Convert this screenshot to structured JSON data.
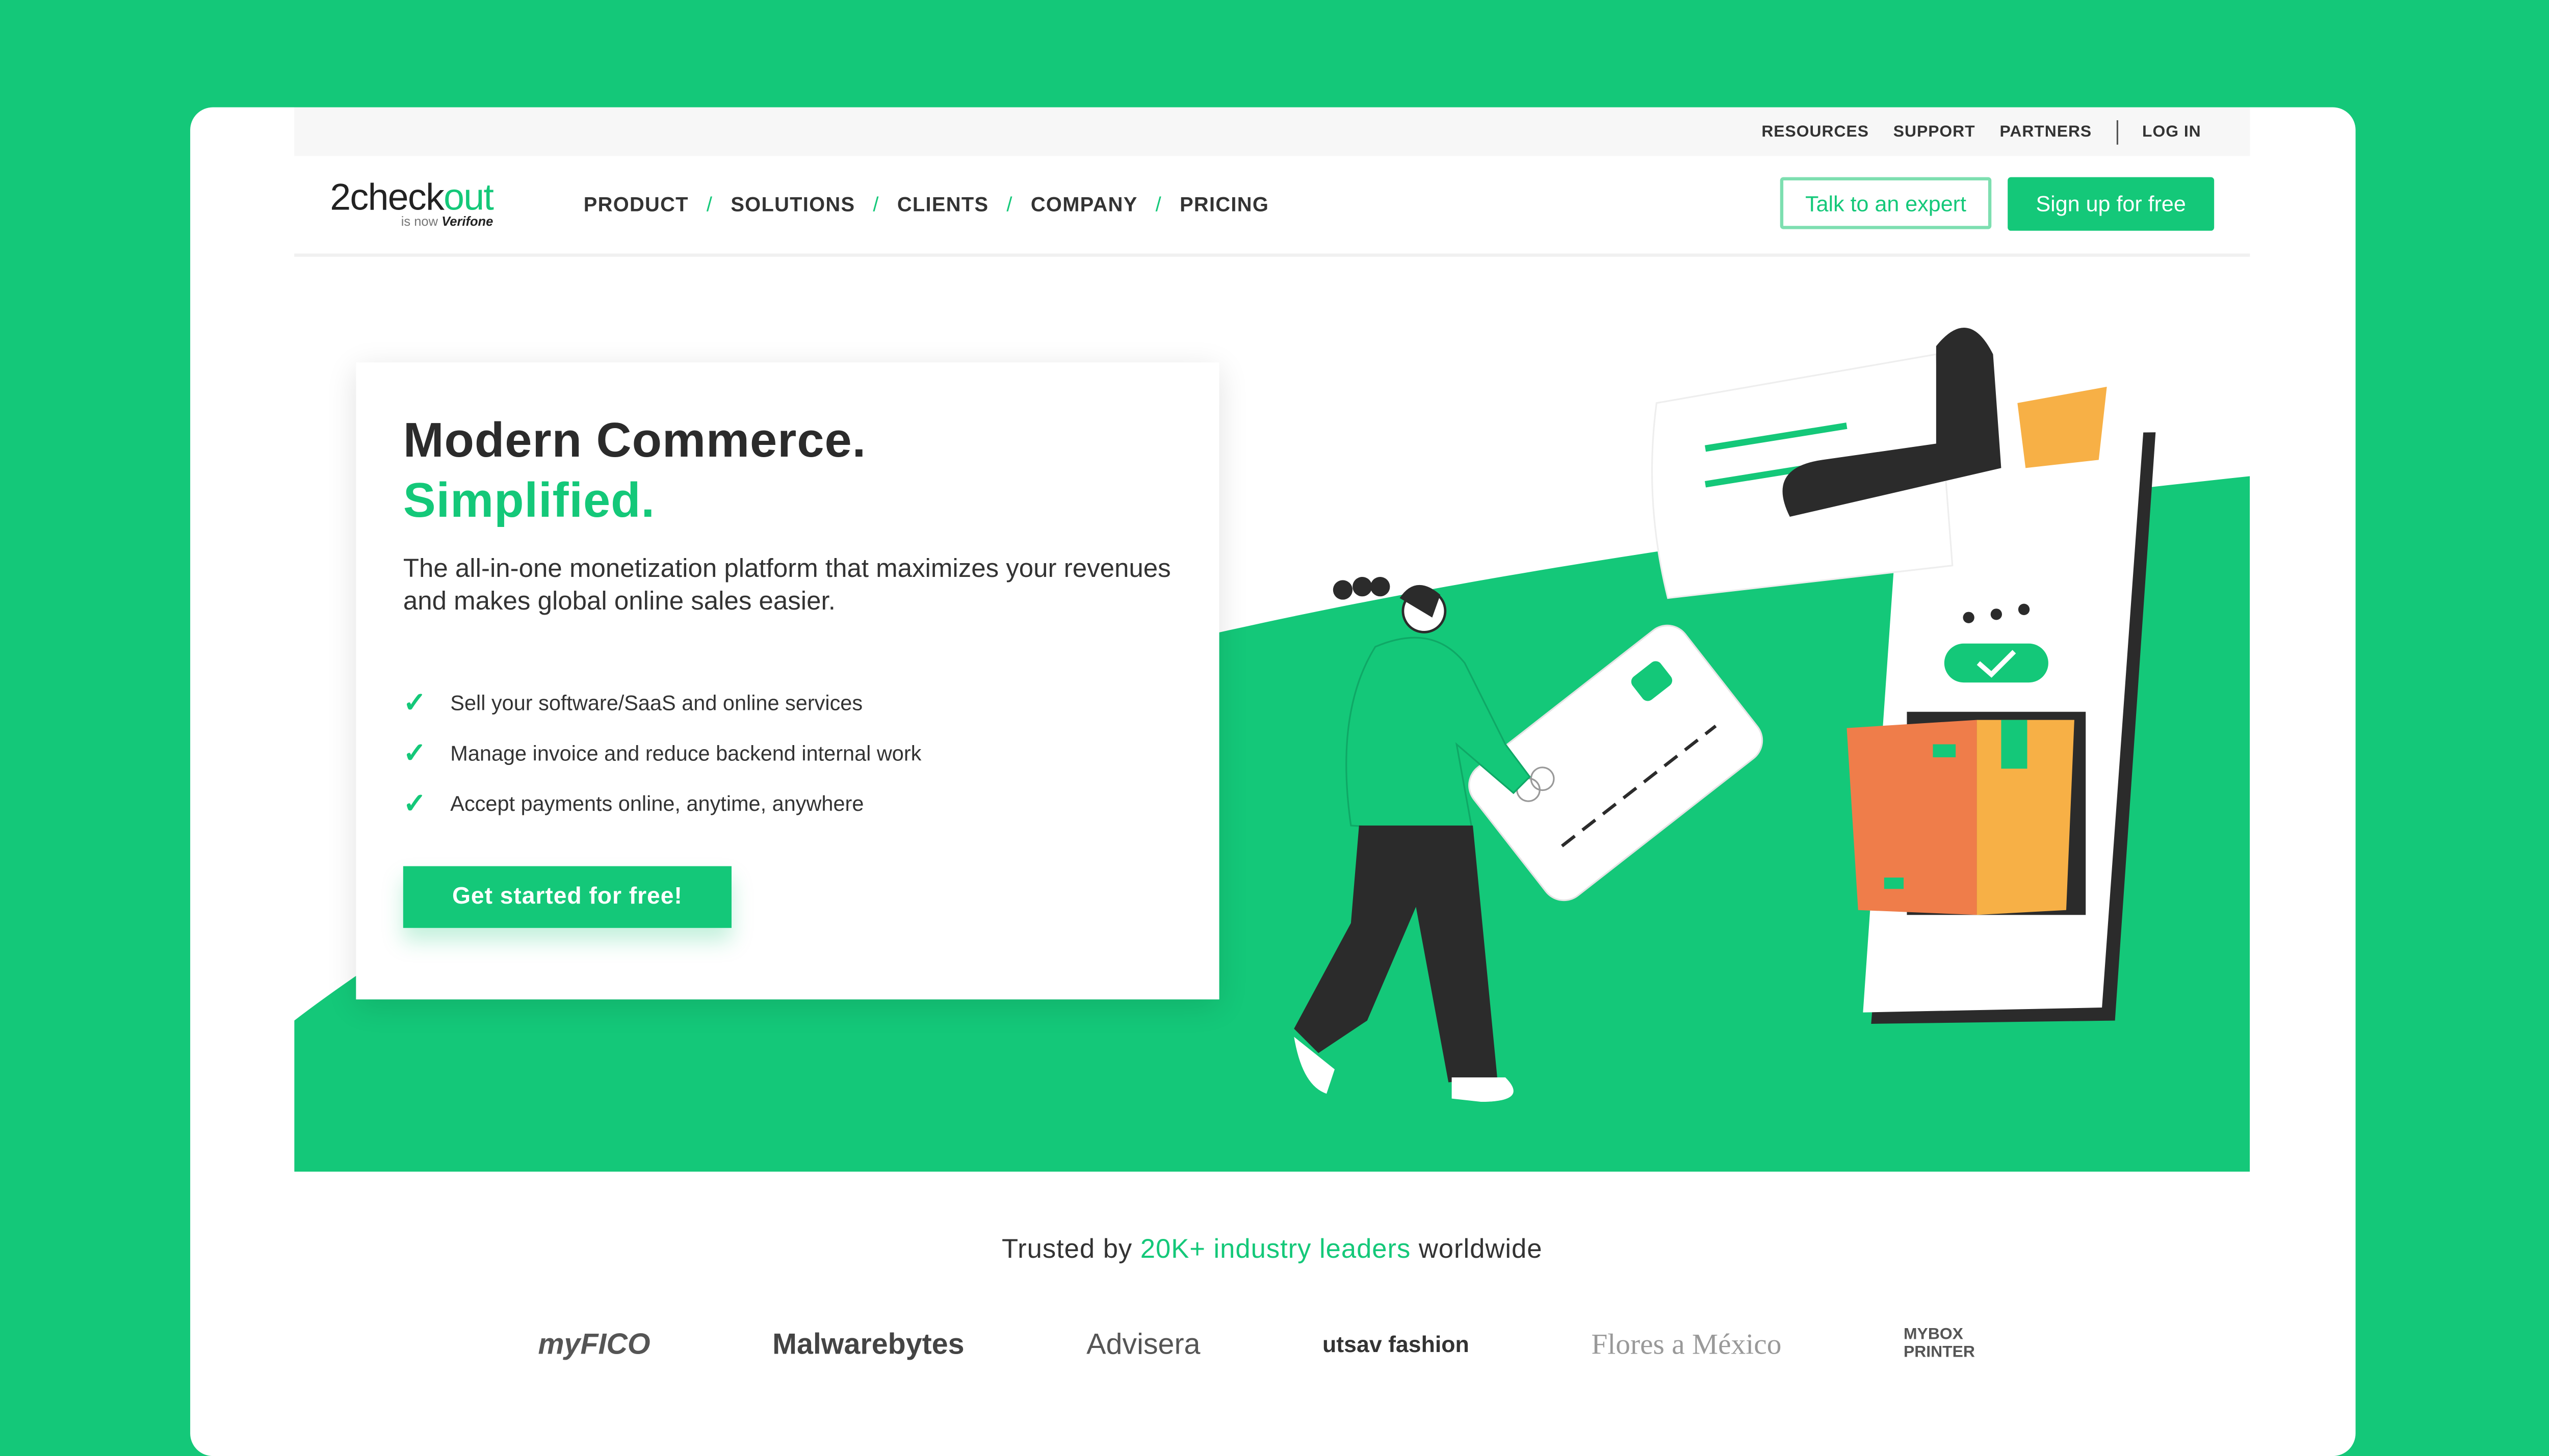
{
  "topbar": {
    "links": [
      "RESOURCES",
      "SUPPORT",
      "PARTNERS",
      "LOG IN"
    ]
  },
  "logo": {
    "text_dark": "2check",
    "text_green": "out",
    "sub_prefix": "is now",
    "sub_brand": "Verifone"
  },
  "nav": {
    "items": [
      "PRODUCT",
      "SOLUTIONS",
      "CLIENTS",
      "COMPANY",
      "PRICING"
    ],
    "separator": "/",
    "talk_label": "Talk to an expert",
    "signup_label": "Sign up for free"
  },
  "hero": {
    "title": "Modern Commerce.",
    "title_accent": "Simplified.",
    "description": "The all-in-one monetization platform that maximizes your revenues and makes global online sales easier.",
    "bullets": [
      "Sell your software/SaaS and online services",
      "Manage invoice and reduce backend internal work",
      "Accept payments online, anytime, anywhere"
    ],
    "check": "✓",
    "cta_label": "Get started for free!"
  },
  "trusted": {
    "prefix": "Trusted by ",
    "accent": "20K+ industry leaders",
    "suffix": " worldwide"
  },
  "logos": [
    "myFICO",
    "Malwarebytes",
    "Advisera",
    "utsav fashion",
    "Flores a México",
    "MYBOX PRINTER"
  ],
  "colors": {
    "brand": "#14c879",
    "text": "#333333",
    "orange": "#ef7d4a",
    "yellow": "#f7b046"
  }
}
